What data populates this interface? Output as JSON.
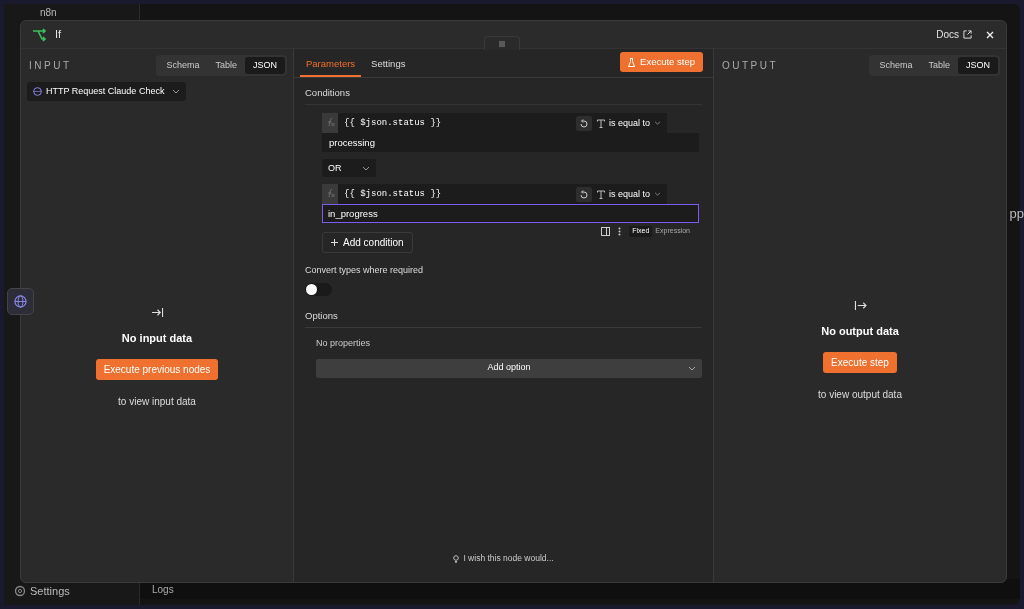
{
  "app": {
    "logo": "n8n",
    "sidebar_footer": "Settings",
    "logs": "Logs",
    "canvas_text": "pp"
  },
  "modal": {
    "title": "If",
    "docs": "Docs"
  },
  "input": {
    "heading": "INPUT",
    "views": [
      {
        "label": "Schema",
        "selected": false
      },
      {
        "label": "Table",
        "selected": false
      },
      {
        "label": "JSON",
        "selected": true
      }
    ],
    "source": "HTTP Request Claude Check",
    "empty_title": "No input data",
    "button": "Execute previous nodes",
    "hint": "to view input data"
  },
  "parameters": {
    "tabs": [
      {
        "label": "Parameters",
        "selected": true
      },
      {
        "label": "Settings",
        "selected": false
      }
    ],
    "execute": "Execute step",
    "conditions_label": "Conditions",
    "conditions": [
      {
        "left": "{{ $json.status }}",
        "operator": "is equal to",
        "right": "processing",
        "focused": false
      },
      {
        "left": "{{ $json.status }}",
        "operator": "is equal to",
        "right": "in_progress",
        "focused": true
      }
    ],
    "combinator": "OR",
    "mode_toggle": [
      {
        "label": "Fixed",
        "selected": true
      },
      {
        "label": "Expression",
        "selected": false
      }
    ],
    "add_condition": "Add condition",
    "convert_label": "Convert types where required",
    "convert_on": false,
    "options_label": "Options",
    "no_properties": "No properties",
    "add_option": "Add option",
    "feedback": "I wish this node would..."
  },
  "output": {
    "heading": "OUTPUT",
    "views": [
      {
        "label": "Schema",
        "selected": false
      },
      {
        "label": "Table",
        "selected": false
      },
      {
        "label": "JSON",
        "selected": true
      }
    ],
    "empty_title": "No output data",
    "button": "Execute step",
    "hint": "to view output data"
  }
}
